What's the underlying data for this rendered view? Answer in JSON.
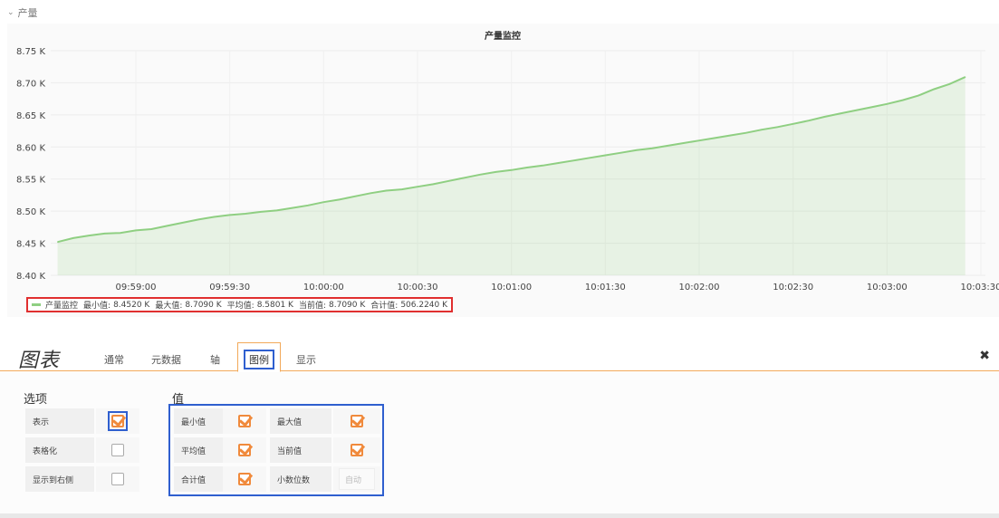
{
  "row": {
    "title": "产量",
    "toggle_icon": "chevron-down-icon"
  },
  "chart_data": {
    "type": "area",
    "title": "产量监控",
    "xlabel": "",
    "ylabel": "",
    "y_ticks": [
      "8.75 K",
      "8.70 K",
      "8.65 K",
      "8.60 K",
      "8.55 K",
      "8.50 K",
      "8.45 K",
      "8.40 K"
    ],
    "ylim": [
      8.4,
      8.75
    ],
    "x_ticks": [
      "09:59:00",
      "09:59:30",
      "10:00:00",
      "10:00:30",
      "10:01:00",
      "10:01:30",
      "10:02:00",
      "10:02:30",
      "10:03:00",
      "10:03:30"
    ],
    "grid": true,
    "series": [
      {
        "name": "产量监控",
        "color": "#8fcf82",
        "x": [
          "09:58:35",
          "09:58:40",
          "09:58:45",
          "09:58:50",
          "09:58:55",
          "09:59:00",
          "09:59:05",
          "09:59:10",
          "09:59:15",
          "09:59:20",
          "09:59:25",
          "09:59:30",
          "09:59:35",
          "09:59:40",
          "09:59:45",
          "09:59:50",
          "09:59:55",
          "10:00:00",
          "10:00:05",
          "10:00:10",
          "10:00:15",
          "10:00:20",
          "10:00:25",
          "10:00:30",
          "10:00:35",
          "10:00:40",
          "10:00:45",
          "10:00:50",
          "10:00:55",
          "10:01:00",
          "10:01:05",
          "10:01:10",
          "10:01:15",
          "10:01:20",
          "10:01:25",
          "10:01:30",
          "10:01:35",
          "10:01:40",
          "10:01:45",
          "10:01:50",
          "10:01:55",
          "10:02:00",
          "10:02:05",
          "10:02:10",
          "10:02:15",
          "10:02:20",
          "10:02:25",
          "10:02:30",
          "10:02:35",
          "10:02:40",
          "10:02:45",
          "10:02:50",
          "10:02:55",
          "10:03:00",
          "10:03:05",
          "10:03:10",
          "10:03:15",
          "10:03:20",
          "10:03:25"
        ],
        "values": [
          8.452,
          8.458,
          8.462,
          8.465,
          8.466,
          8.47,
          8.472,
          8.477,
          8.482,
          8.487,
          8.491,
          8.494,
          8.496,
          8.499,
          8.501,
          8.505,
          8.509,
          8.514,
          8.518,
          8.523,
          8.528,
          8.532,
          8.534,
          8.538,
          8.542,
          8.547,
          8.552,
          8.557,
          8.561,
          8.564,
          8.568,
          8.571,
          8.575,
          8.579,
          8.583,
          8.587,
          8.591,
          8.595,
          8.598,
          8.602,
          8.606,
          8.61,
          8.614,
          8.618,
          8.622,
          8.627,
          8.631,
          8.636,
          8.641,
          8.647,
          8.652,
          8.657,
          8.662,
          8.667,
          8.673,
          8.68,
          8.69,
          8.698,
          8.709
        ]
      }
    ],
    "legend": {
      "position": "bottom-left",
      "name": "产量监控",
      "items": [
        {
          "label": "最小值:",
          "value": "8.4520 K"
        },
        {
          "label": "最大值:",
          "value": "8.7090 K"
        },
        {
          "label": "平均值:",
          "value": "8.5801 K"
        },
        {
          "label": "当前值:",
          "value": "8.7090 K"
        },
        {
          "label": "合计值:",
          "value": "506.2240 K"
        }
      ]
    }
  },
  "editor": {
    "title": "图表",
    "tabs": [
      "通常",
      "元数据",
      "轴",
      "图例",
      "显示"
    ],
    "active_tab": "图例",
    "close_icon": "close-icon",
    "options": {
      "title": "选项",
      "rows": [
        {
          "label": "表示",
          "checked": true
        },
        {
          "label": "表格化",
          "checked": false
        },
        {
          "label": "显示到右侧",
          "checked": false
        }
      ]
    },
    "values": {
      "title": "值",
      "rows": [
        {
          "label": "最小值",
          "checked": true,
          "label2": "最大值",
          "checked2": true
        },
        {
          "label": "平均值",
          "checked": true,
          "label2": "当前值",
          "checked2": true
        },
        {
          "label": "合计值",
          "checked": true,
          "label2": "小数位数",
          "input_placeholder": "自动"
        }
      ]
    },
    "accent": "#f08a3c",
    "highlight": "#2f5fcf"
  }
}
